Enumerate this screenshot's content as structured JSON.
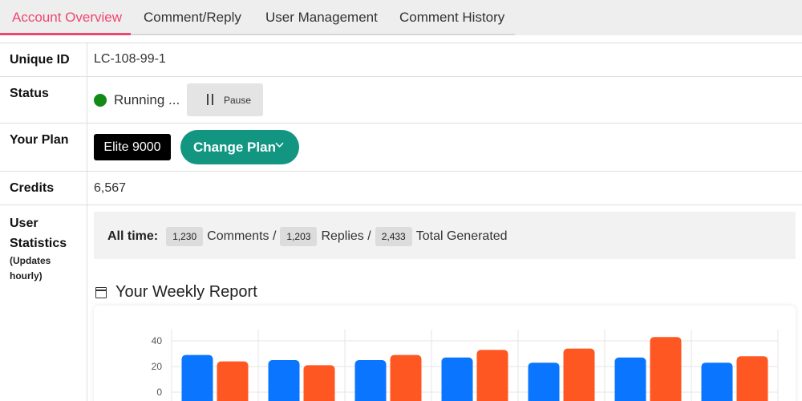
{
  "tabs": [
    {
      "label": "Account Overview",
      "active": true
    },
    {
      "label": "Comment/Reply",
      "active": false
    },
    {
      "label": "User Management",
      "active": false
    },
    {
      "label": "Comment History",
      "active": false
    }
  ],
  "account": {
    "unique_id_label": "Unique ID",
    "unique_id": "LC-108-99-1",
    "status_label": "Status",
    "status_text": "Running ...",
    "status_color": "#138a13",
    "pause_label": "Pause",
    "plan_label": "Your Plan",
    "plan_name": "Elite 9000",
    "change_plan_label": "Change Plan",
    "credits_label": "Credits",
    "credits": "6,567",
    "stats_label": "User Statistics",
    "stats_sublabel": "(Updates hourly)"
  },
  "stats": {
    "prefix": "All time:",
    "comments": "1,230",
    "comments_label": "Comments /",
    "replies": "1,203",
    "replies_label": "Replies /",
    "total": "2,433",
    "total_label": "Total Generated"
  },
  "report": {
    "title": "Your Weekly Report"
  },
  "colors": {
    "accent": "#ef476f",
    "primary_button": "#129682",
    "series_blue": "#0a75ff",
    "series_orange": "#ff5722"
  },
  "chart_data": {
    "type": "bar",
    "categories": [
      "",
      "",
      "",
      "",
      "",
      "",
      ""
    ],
    "series": [
      {
        "values": [
          29,
          25,
          25,
          27,
          23,
          27,
          23
        ],
        "color": "#0a75ff"
      },
      {
        "values": [
          24,
          21,
          29,
          33,
          34,
          43,
          28
        ],
        "color": "#ff5722"
      }
    ],
    "yticks": [
      0,
      20,
      40
    ],
    "ylim": [
      0,
      50
    ],
    "grid": true
  }
}
